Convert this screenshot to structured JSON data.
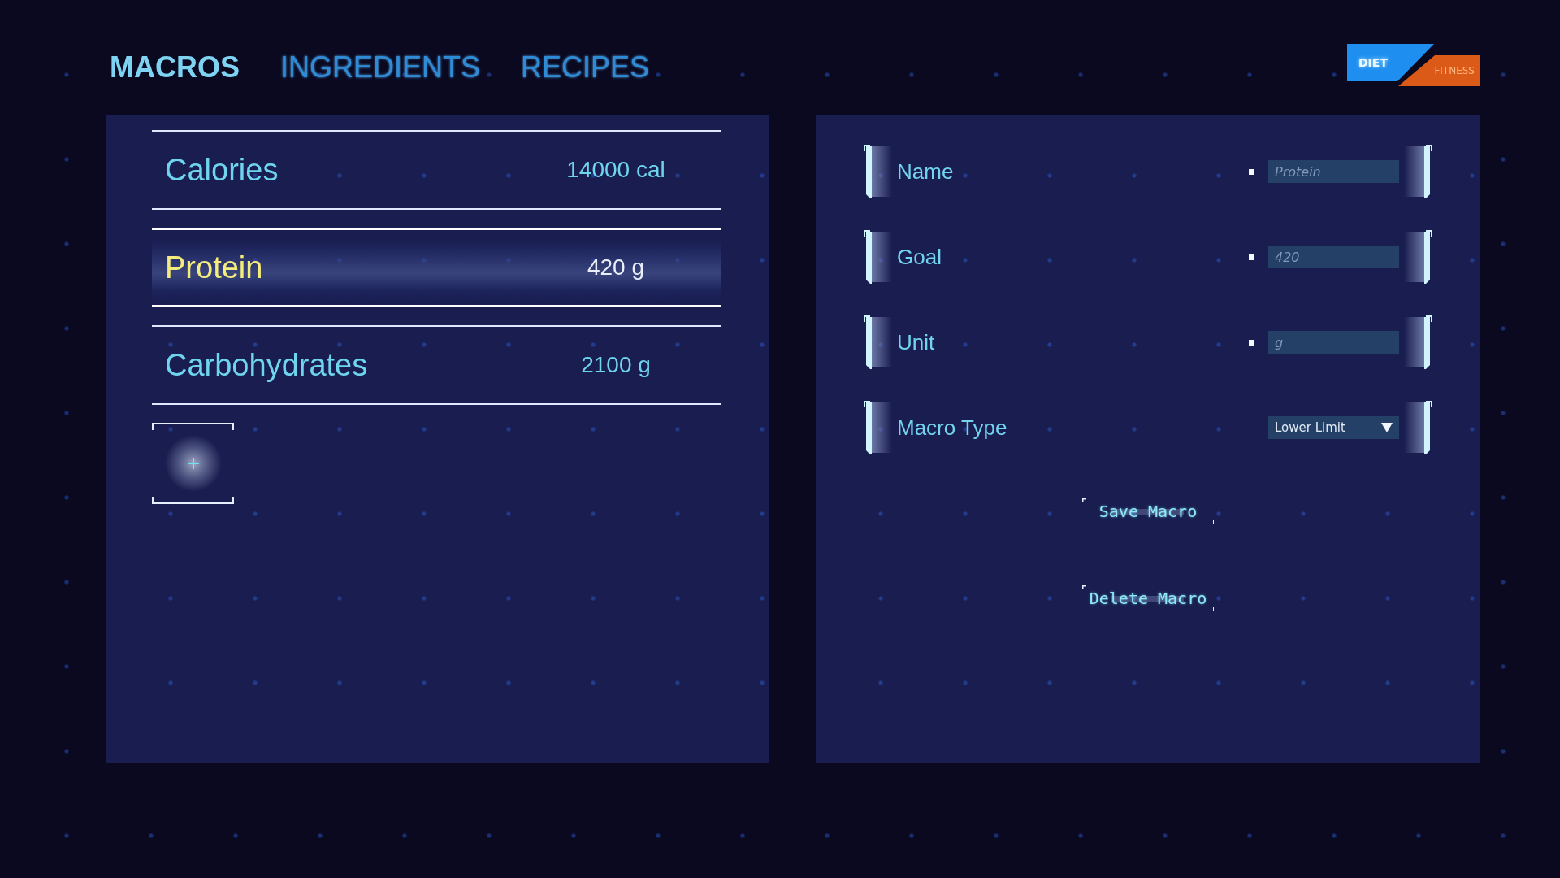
{
  "tabs": [
    {
      "label": "MACROS",
      "selected": true
    },
    {
      "label": "INGREDIENTS",
      "selected": false
    },
    {
      "label": "RECIPES",
      "selected": false
    }
  ],
  "mode_switch": [
    {
      "label": "DIET",
      "selected": true,
      "color": "#1e8ff0"
    },
    {
      "label": "FITNESS",
      "selected": false,
      "color": "#dc5a18"
    }
  ],
  "macro_list": {
    "items": [
      {
        "name": "Calories",
        "amount": "14000 cal",
        "selected": false
      },
      {
        "name": "Protein",
        "amount": "420 g",
        "selected": true
      },
      {
        "name": "Carbohydrates",
        "amount": "2100 g",
        "selected": false
      }
    ]
  },
  "macro_form": {
    "fields": [
      {
        "kind": "text",
        "label": "Name",
        "placeholder": "Protein"
      },
      {
        "kind": "text",
        "label": "Goal",
        "placeholder": "420"
      },
      {
        "kind": "text",
        "label": "Unit",
        "placeholder": "g"
      },
      {
        "kind": "select",
        "label": "Macro Type",
        "value": "Lower Limit"
      }
    ],
    "buttons": [
      {
        "label": "Save Macro"
      },
      {
        "label": "Delete Macro"
      }
    ]
  }
}
